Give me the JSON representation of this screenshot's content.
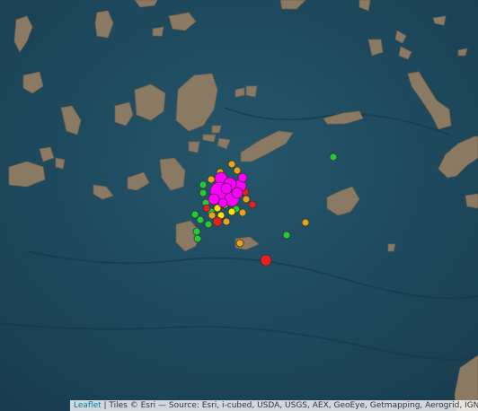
{
  "map": {
    "attribution": {
      "leaflet_link": "Leaflet",
      "separator": " | ",
      "text": "Tiles © Esri — Source: Esri, i-cubed, USDA, USGS, AEX, GeoEye, Getmapping, Aerogrid, IGN, IGP, UPR-EGP, and the GIS User Community"
    },
    "marker_colors": {
      "magenta": "#ff00ff",
      "orange": "#e8a317",
      "green": "#22cc33",
      "red": "#e82020",
      "yellow": "#f5e400"
    },
    "sea_color": "#1f4a5e",
    "land_color": "#8a7a63"
  }
}
